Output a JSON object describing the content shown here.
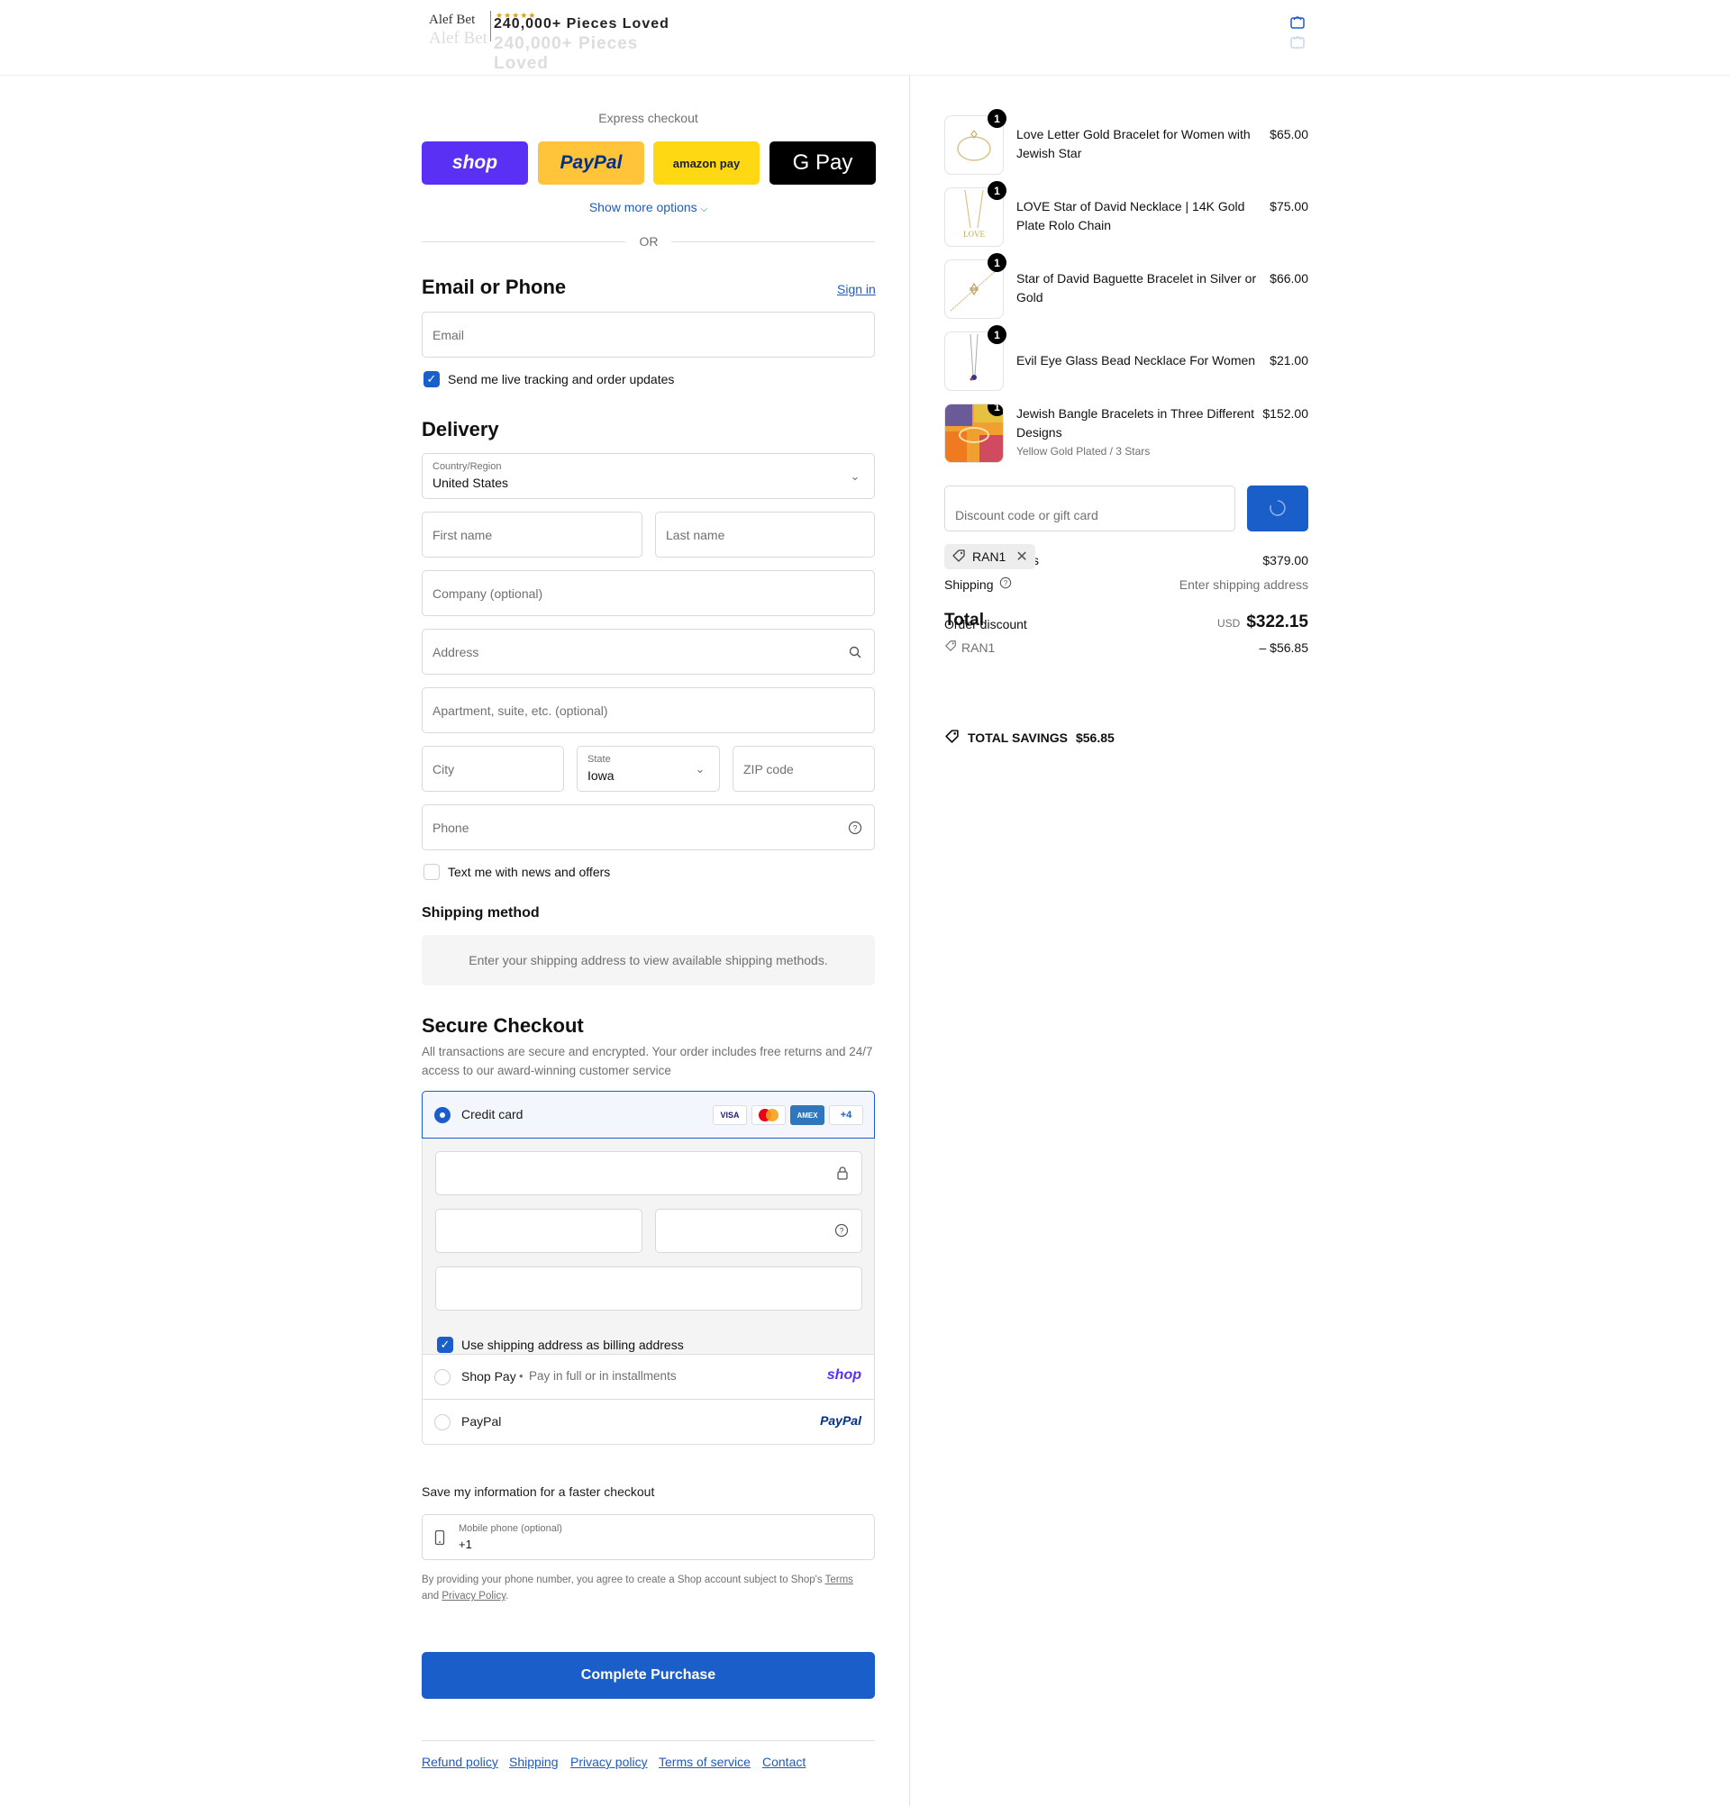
{
  "header": {
    "brand": "Alef Bet",
    "stars": "★★★★★",
    "tagline": "240,000+ Pieces Loved"
  },
  "express": {
    "title": "Express checkout",
    "buttons": [
      {
        "label": "shop",
        "bg": "#5a31f4",
        "color": "#ffffff"
      },
      {
        "label": "PayPal",
        "bg": "#ffc439",
        "color": "#003087"
      },
      {
        "label": "amazon pay",
        "bg": "#ffd814",
        "color": "#222222"
      },
      {
        "label": "G Pay",
        "bg": "#000000",
        "color": "#ffffff"
      }
    ],
    "show_more": "Show more options",
    "or": "OR"
  },
  "contact": {
    "heading": "Email or Phone",
    "sign_in": "Sign in",
    "email_placeholder": "Email",
    "tracking_label": "Send me live tracking and order updates",
    "tracking_checked": true
  },
  "delivery": {
    "heading": "Delivery",
    "country_label": "Country/Region",
    "country_value": "United States",
    "first_name": "First name",
    "last_name": "Last name",
    "company": "Company (optional)",
    "address": "Address",
    "apartment": "Apartment, suite, etc. (optional)",
    "city": "City",
    "state_label": "State",
    "state_value": "Iowa",
    "zip": "ZIP code",
    "phone": "Phone",
    "sms_label": "Text me with news and offers",
    "sms_checked": false
  },
  "shipping_method": {
    "heading": "Shipping method",
    "info": "Enter your shipping address to view available shipping methods."
  },
  "payment": {
    "heading": "Secure Checkout",
    "description": "All transactions are secure and encrypted. Your order includes free returns and 24/7 access to our award-winning customer service",
    "credit_card_label": "Credit card",
    "cards": [
      "VISA",
      "MC",
      "AMEX",
      "+4"
    ],
    "billing_label": "Use shipping address as billing address",
    "billing_checked": true,
    "shop_pay_label": "Shop Pay",
    "shop_pay_sub": "Pay in full or in installments",
    "shop_pay_logo": "shop",
    "paypal_label": "PayPal",
    "paypal_logo": "PayPal"
  },
  "save_info": {
    "heading": "Save my information for a faster checkout",
    "mobile_label": "Mobile phone (optional)",
    "mobile_value": "+1",
    "legal_prefix": "By providing your phone number, you agree to create a Shop account subject to Shop's",
    "terms": "Terms",
    "and": "and",
    "privacy": "Privacy Policy",
    "period": "."
  },
  "complete_button": "Complete Purchase",
  "footer_links": [
    "Refund policy",
    "Shipping",
    "Privacy policy",
    "Terms of service",
    "Contact"
  ],
  "order": {
    "items": [
      {
        "name": "Love Letter Gold Bracelet for Women with Jewish Star",
        "price": "$65.00",
        "qty": "1",
        "variant": ""
      },
      {
        "name": "LOVE Star of David Necklace | 14K Gold Plate Rolo Chain",
        "price": "$75.00",
        "qty": "1",
        "variant": ""
      },
      {
        "name": "Star of David Baguette Bracelet in Silver or Gold",
        "price": "$66.00",
        "qty": "1",
        "variant": ""
      },
      {
        "name": "Evil Eye Glass Bead Necklace For Women",
        "price": "$21.00",
        "qty": "1",
        "variant": ""
      },
      {
        "name": "Jewish Bangle Bracelets in Three Different Designs",
        "price": "$152.00",
        "qty": "1",
        "variant": "Yellow Gold Plated / 3 Stars"
      }
    ],
    "discount_placeholder": "Discount code or gift card",
    "applied_code": "RAN1",
    "subtotal_value": "$379.00",
    "subtotal_suffix": "s",
    "shipping_label": "Shipping",
    "shipping_value": "Enter shipping address",
    "total_label": "Total",
    "order_discount_label": "Order discount",
    "currency": "USD",
    "total_value": "$322.15",
    "discount_code": "RAN1",
    "discount_value": "– $56.85",
    "savings_label": "TOTAL SAVINGS",
    "savings_value": "$56.85"
  },
  "colors": {
    "accent": "#1a5ec9",
    "link": "#1f5bbf"
  }
}
